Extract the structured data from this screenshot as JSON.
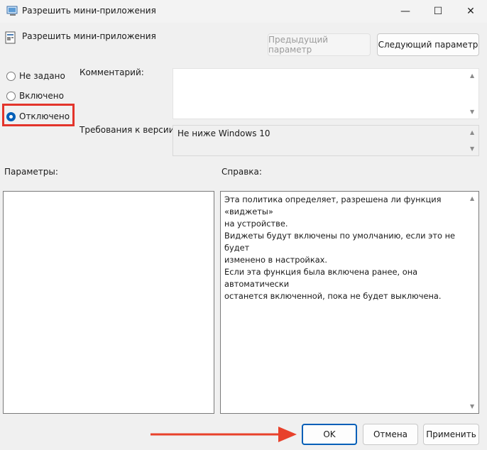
{
  "window": {
    "title": "Разрешить мини-приложения",
    "controls": {
      "minimize": "—",
      "maximize": "☐",
      "close": "✕"
    }
  },
  "header": {
    "policy_name": "Разрешить мини-приложения",
    "prev_button": "Предыдущий параметр",
    "next_button": "Следующий параметр"
  },
  "state": {
    "options": [
      {
        "label": "Не задано",
        "checked": false
      },
      {
        "label": "Включено",
        "checked": false
      },
      {
        "label": "Отключено",
        "checked": true
      }
    ]
  },
  "labels": {
    "comment": "Комментарий:",
    "version": "Требования к версии:",
    "params": "Параметры:",
    "help": "Справка:"
  },
  "version_value": "Не ниже Windows 10",
  "comment_value": "",
  "help_text": "Эта политика определяет, разрешена ли функция «виджеты»\nна устройстве.\nВиджеты будут включены по умолчанию, если это не будет\nизменено в настройках.\nЕсли эта функция была включена ранее, она автоматически\nостанется включенной, пока не будет выключена.",
  "footer": {
    "ok": "OK",
    "cancel": "Отмена",
    "apply": "Применить"
  },
  "colors": {
    "accent": "#005fb8",
    "highlight_red": "#e3342b"
  }
}
